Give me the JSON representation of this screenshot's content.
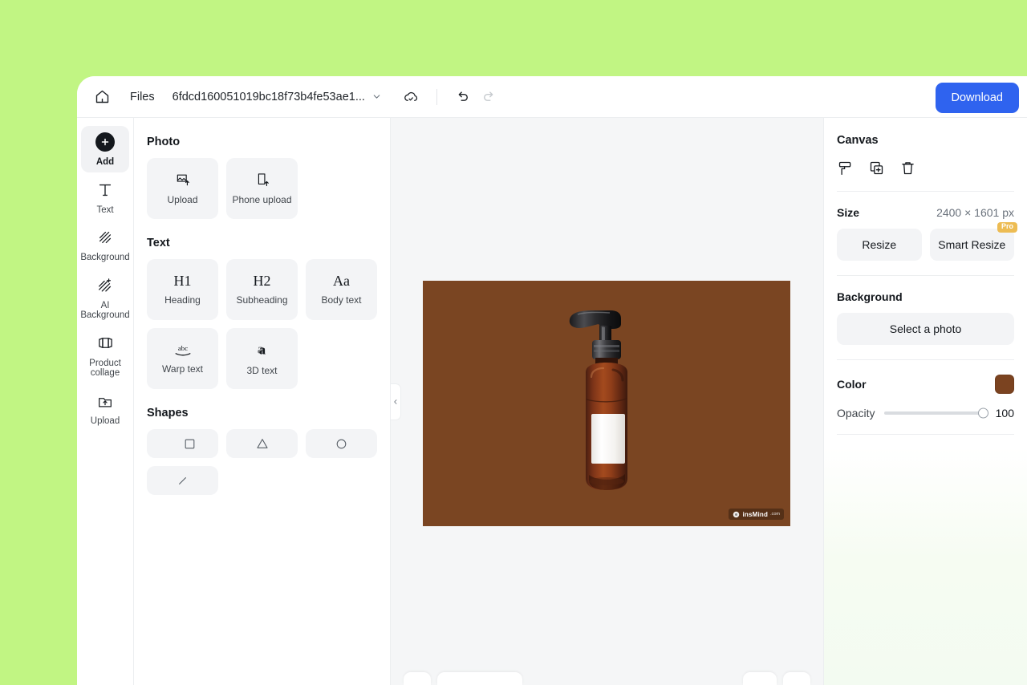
{
  "theme": {
    "page_background": "#c1f583",
    "accent_blue": "#2f63ef",
    "pro_badge": "#edbc53",
    "canvas_brown": "#7a4522",
    "swatch_brown": "#7b4320"
  },
  "topbar": {
    "home_icon": "home-icon",
    "files_label": "Files",
    "filename": "6fdcd160051019bc18f73b4fe53ae1...",
    "dropdown_icon": "chevron-down-icon",
    "cloud_icon": "cloud-check-icon",
    "undo_icon": "undo-icon",
    "redo_icon": "redo-icon",
    "download_label": "Download"
  },
  "rail": {
    "items": [
      {
        "label": "Add",
        "icon": "plus-circle-icon",
        "active": true
      },
      {
        "label": "Text",
        "icon": "text-t-icon",
        "active": false
      },
      {
        "label": "Background",
        "icon": "hatch-square-icon",
        "active": false
      },
      {
        "label": "AI Background",
        "icon": "hatch-sparkle-icon",
        "active": false
      },
      {
        "label": "Product collage",
        "icon": "collage-icon",
        "active": false
      },
      {
        "label": "Upload",
        "icon": "folder-upload-icon",
        "active": false
      }
    ]
  },
  "left_panel": {
    "photo": {
      "heading": "Photo",
      "tiles": [
        {
          "label": "Upload",
          "icon": "image-upload-icon"
        },
        {
          "label": "Phone upload",
          "icon": "phone-upload-icon"
        }
      ]
    },
    "text": {
      "heading": "Text",
      "tiles": [
        {
          "label": "Heading",
          "glyph": "H1",
          "icon": "h1-icon"
        },
        {
          "label": "Subheading",
          "glyph": "H2",
          "icon": "h2-icon"
        },
        {
          "label": "Body text",
          "glyph": "Aa",
          "icon": "aa-icon"
        },
        {
          "label": "Warp text",
          "glyph": "abc",
          "icon": "warp-text-icon"
        },
        {
          "label": "3D text",
          "glyph": "a",
          "icon": "three-d-text-icon"
        }
      ]
    },
    "shapes": {
      "heading": "Shapes",
      "tiles": [
        {
          "icon": "square-shape-icon",
          "name": "square"
        },
        {
          "icon": "triangle-shape-icon",
          "name": "triangle"
        },
        {
          "icon": "circle-shape-icon",
          "name": "circle"
        },
        {
          "icon": "line-shape-icon",
          "name": "line"
        }
      ]
    }
  },
  "canvas": {
    "collapse_icon": "chevron-left-icon",
    "artboard": {
      "background_color": "#7a4522",
      "product": "amber-pump-bottle",
      "watermark_text": "insMind",
      "watermark_tld": ".com",
      "watermark_icon": "insmind-logo-icon"
    }
  },
  "right_panel": {
    "title": "Canvas",
    "tools": [
      {
        "icon": "paint-roller-icon",
        "name": "paint-roller"
      },
      {
        "icon": "duplicate-icon",
        "name": "duplicate"
      },
      {
        "icon": "trash-icon",
        "name": "delete"
      }
    ],
    "size": {
      "label": "Size",
      "value": "2400 × 1601 px"
    },
    "resize_label": "Resize",
    "smart_resize_label": "Smart Resize",
    "pro_badge": "Pro",
    "background": {
      "heading": "Background",
      "select_photo_label": "Select a photo"
    },
    "color": {
      "label": "Color",
      "value": "#7b4320"
    },
    "opacity": {
      "label": "Opacity",
      "value": "100"
    }
  }
}
